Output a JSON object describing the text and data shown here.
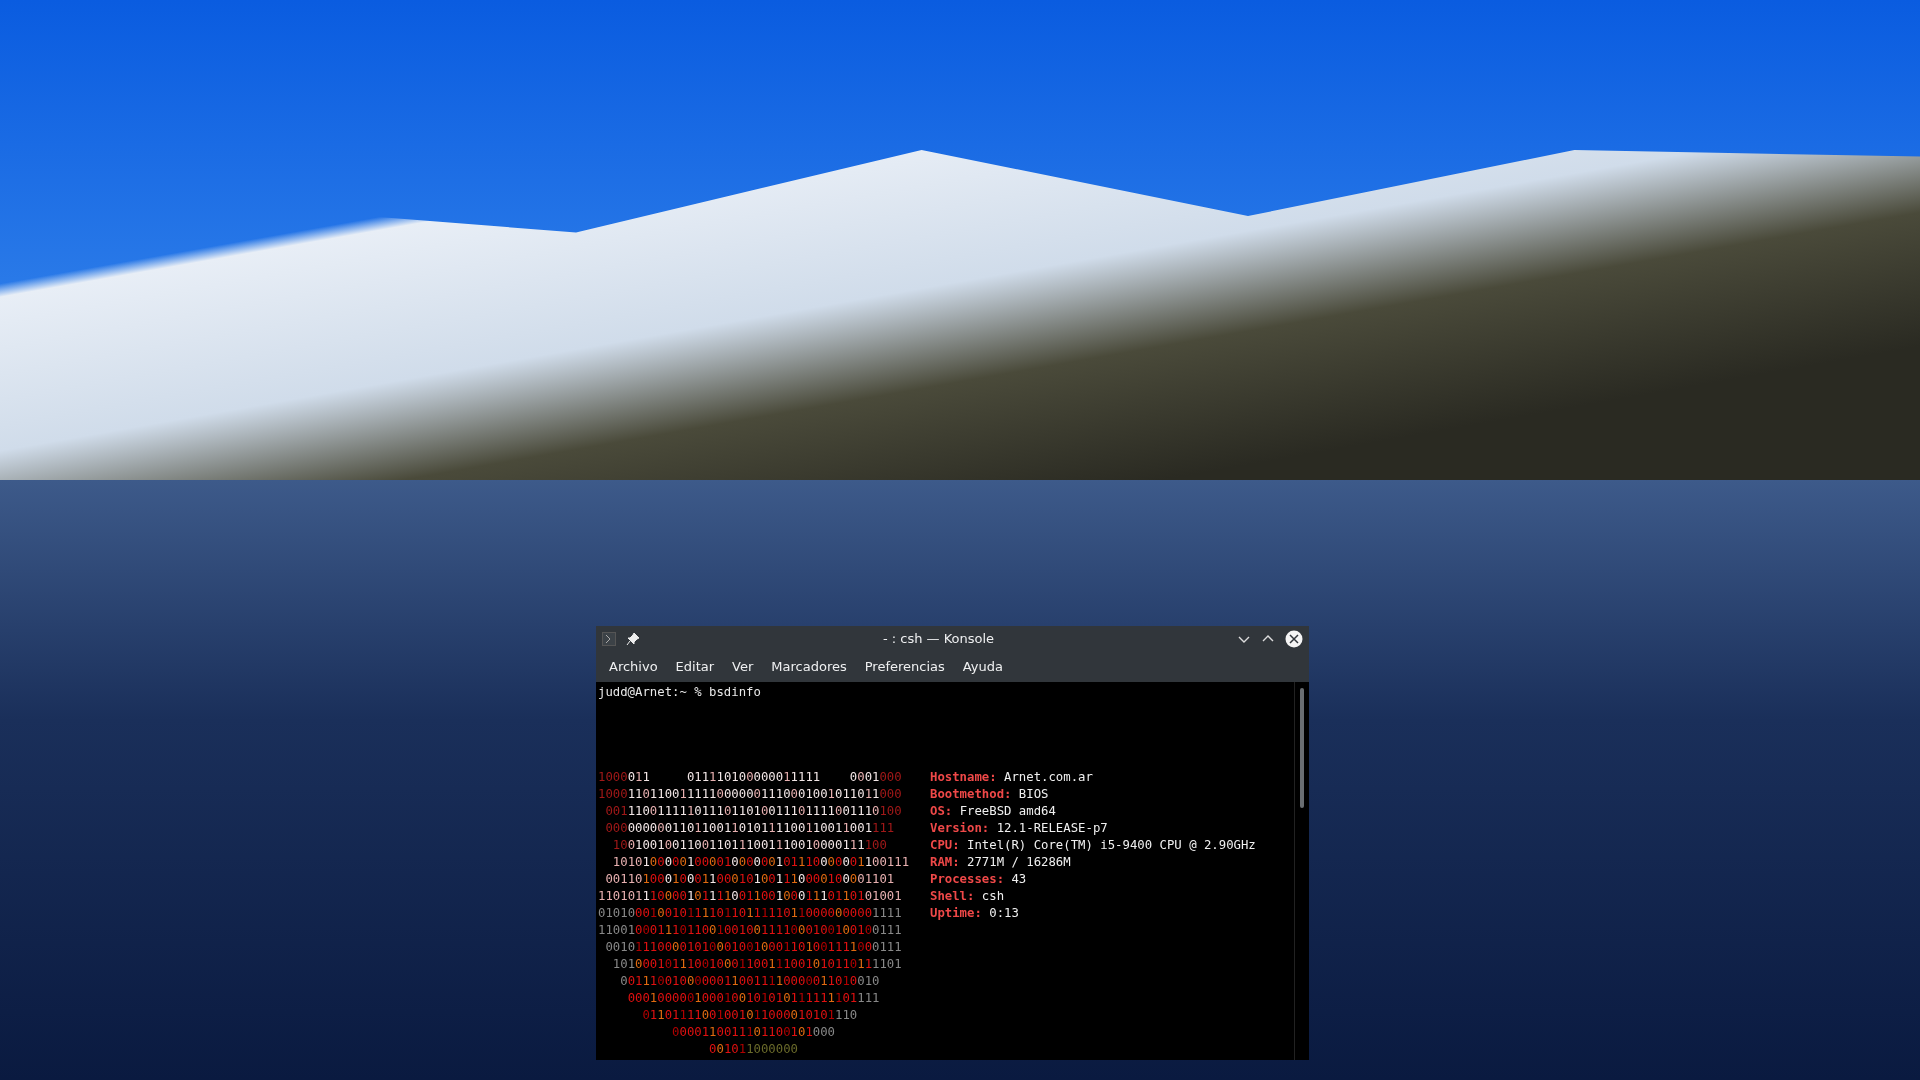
{
  "window": {
    "title": "- : csh — Konsole"
  },
  "menu": [
    "Archivo",
    "Editar",
    "Ver",
    "Marcadores",
    "Preferencias",
    "Ayuda"
  ],
  "terminal": {
    "prompt_line": "judd@Arnet:~ % bsdinfo",
    "ascii_art": [
      "1000011     011110100000011111    0001000",
      "10001101100111110000001110001001011011000",
      " 0011100111110111011010011101111001110100",
      " 000000000110110011010111100110011001111",
      "  1001001001100110111001110010000111100",
      "  1010100000100001000000101110000001100111",
      " 001101000100011000101001110000100001101",
      "11010111000010111100110010001110110101001",
      "01010001001011110110111110110000000001111",
      "11001000111011001001001111000100100100111",
      " 0010111000010100010010001101001111000111",
      "  101000101110010001100111001010110111101",
      "   00111001000000110011110000011010010",
      "    0001000001000100101010111111101111",
      "      01101111001001011000010101110",
      "          0000110011101100101000",
      "               001011000000"
    ],
    "info": [
      {
        "label": "Hostname:",
        "value": "Arnet.com.ar"
      },
      {
        "label": "Bootmethod:",
        "value": "BIOS"
      },
      {
        "label": "OS:",
        "value": "FreeBSD amd64"
      },
      {
        "label": "Version:",
        "value": "12.1-RELEASE-p7"
      },
      {
        "label": "CPU:",
        "value": "Intel(R) Core(TM) i5-9400 CPU @ 2.90GHz"
      },
      {
        "label": "RAM:",
        "value": "2771M / 16286M"
      },
      {
        "label": "Processes:",
        "value": "43"
      },
      {
        "label": "Shell:",
        "value": "csh"
      },
      {
        "label": "Uptime:",
        "value": "0:13"
      }
    ]
  }
}
